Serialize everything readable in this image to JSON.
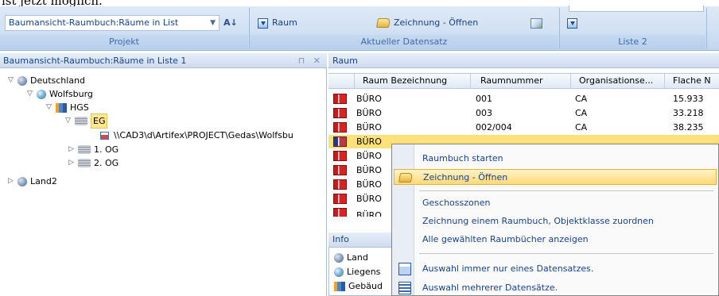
{
  "caption": "ist jetzt möglich.",
  "ribbon": {
    "combo_value": "Baumansicht-Raumbuch:Räume in List",
    "sort_icon": "sort-az-icon",
    "btn_raum": "Raum",
    "btn_zeichnung": "Zeichnung - Öffnen",
    "group_projekt": "Projekt",
    "group_datensatz": "Aktueller Datensatz",
    "group_liste2": "Liste 2"
  },
  "left_panel": {
    "title": "Baumansicht-Raumbuch:Räume in Liste 1",
    "pin": "⊓",
    "close": "✕",
    "tree": [
      {
        "label": "Deutschland"
      },
      {
        "label": "Wolfsburg"
      },
      {
        "label": "HGS"
      },
      {
        "label": "EG"
      },
      {
        "label": "\\\\CAD3\\d\\Artifex\\PROJECT\\Gedas\\Wolfsbu"
      },
      {
        "label": "1. OG"
      },
      {
        "label": "2. OG"
      },
      {
        "label": "Land2"
      }
    ]
  },
  "right_panel": {
    "title": "Raum",
    "columns": [
      "Raum Bezeichnung",
      "Raumnummer",
      "Organisationse...",
      "Flache N"
    ],
    "rows": [
      {
        "name": "BÜRO",
        "nr": "001",
        "org": "CA",
        "flaeche": "15.933"
      },
      {
        "name": "BÜRO",
        "nr": "003",
        "org": "CA",
        "flaeche": "33.218"
      },
      {
        "name": "BÜRO",
        "nr": "002/004",
        "org": "CA",
        "flaeche": "38.235"
      },
      {
        "name": "BÜRO",
        "nr": "",
        "org": "",
        "flaeche": ""
      },
      {
        "name": "BÜRO",
        "nr": "",
        "org": "",
        "flaeche": ""
      },
      {
        "name": "BÜRO",
        "nr": "",
        "org": "",
        "flaeche": ""
      },
      {
        "name": "BÜRO",
        "nr": "",
        "org": "",
        "flaeche": ""
      },
      {
        "name": "BÜRO",
        "nr": "",
        "org": "",
        "flaeche": ""
      },
      {
        "name": "BÜRO",
        "nr": "",
        "org": "",
        "flaeche": ""
      }
    ]
  },
  "info_panel": {
    "title": "Info",
    "items": [
      "Land",
      "Liegens",
      "Gebäud"
    ]
  },
  "context_menu": {
    "items": [
      "Raumbuch starten",
      "Zeichnung - Öffnen",
      "Geschosszonen",
      "Zeichnung einem Raumbuch, Objektklasse zuordnen",
      "Alle gewählten Raumbücher anzeigen",
      "Auswahl immer nur eines Datensatzes.",
      "Auswahl mehrerer Datensätze."
    ]
  },
  "colors": {
    "ribbon_bg": "#d2e1f4",
    "selection": "#ffe88d",
    "menu_highlight": "#ffd97a",
    "text_blue": "#15428b"
  }
}
